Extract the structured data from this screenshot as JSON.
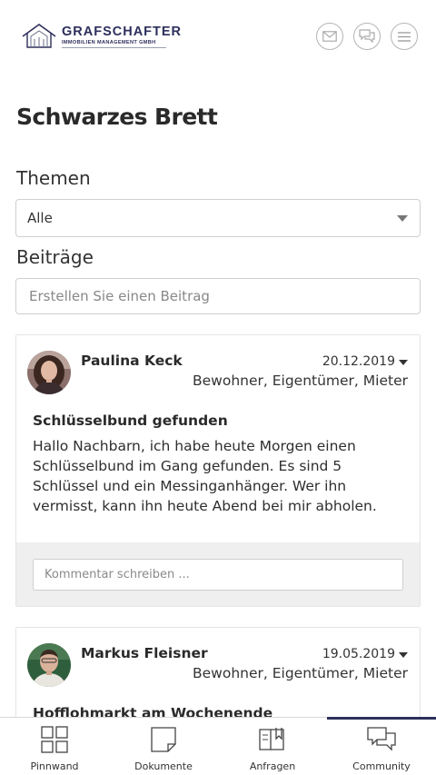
{
  "header": {
    "brand_name": "GRAFSCHAFTER",
    "brand_tagline": "IMMOBILIEN MANAGEMENT GMBH",
    "icons": [
      "mail-icon",
      "chat-icon",
      "menu-icon"
    ],
    "brand_color": "#2d2f5c"
  },
  "page": {
    "title": "Schwarzes Brett",
    "topics_label": "Themen",
    "topics_selected": "Alle",
    "posts_label": "Beiträge",
    "create_placeholder": "Erstellen Sie einen Beitrag"
  },
  "posts": [
    {
      "author": "Paulina Keck",
      "date": "20.12.2019",
      "audience": "Bewohner, Eigentümer, Mieter",
      "title": "Schlüsselbund gefunden",
      "body": "Hallo Nachbarn, ich habe heute Morgen einen Schlüsselbund im Gang gefunden. Es sind 5 Schlüssel und ein Messinganhänger. Wer ihn vermisst, kann ihn heute Abend bei mir abholen.",
      "comment_placeholder": "Kommentar schreiben ..."
    },
    {
      "author": "Markus Fleisner",
      "date": "19.05.2019",
      "audience": "Bewohner, Eigentümer, Mieter",
      "title": "Hofflohmarkt am Wochenende"
    }
  ],
  "bottom_nav": [
    {
      "label": "Pinnwand",
      "icon": "grid-icon",
      "active": false
    },
    {
      "label": "Dokumente",
      "icon": "document-icon",
      "active": false
    },
    {
      "label": "Anfragen",
      "icon": "requests-icon",
      "active": false
    },
    {
      "label": "Community",
      "icon": "community-chat-icon",
      "active": true
    }
  ]
}
